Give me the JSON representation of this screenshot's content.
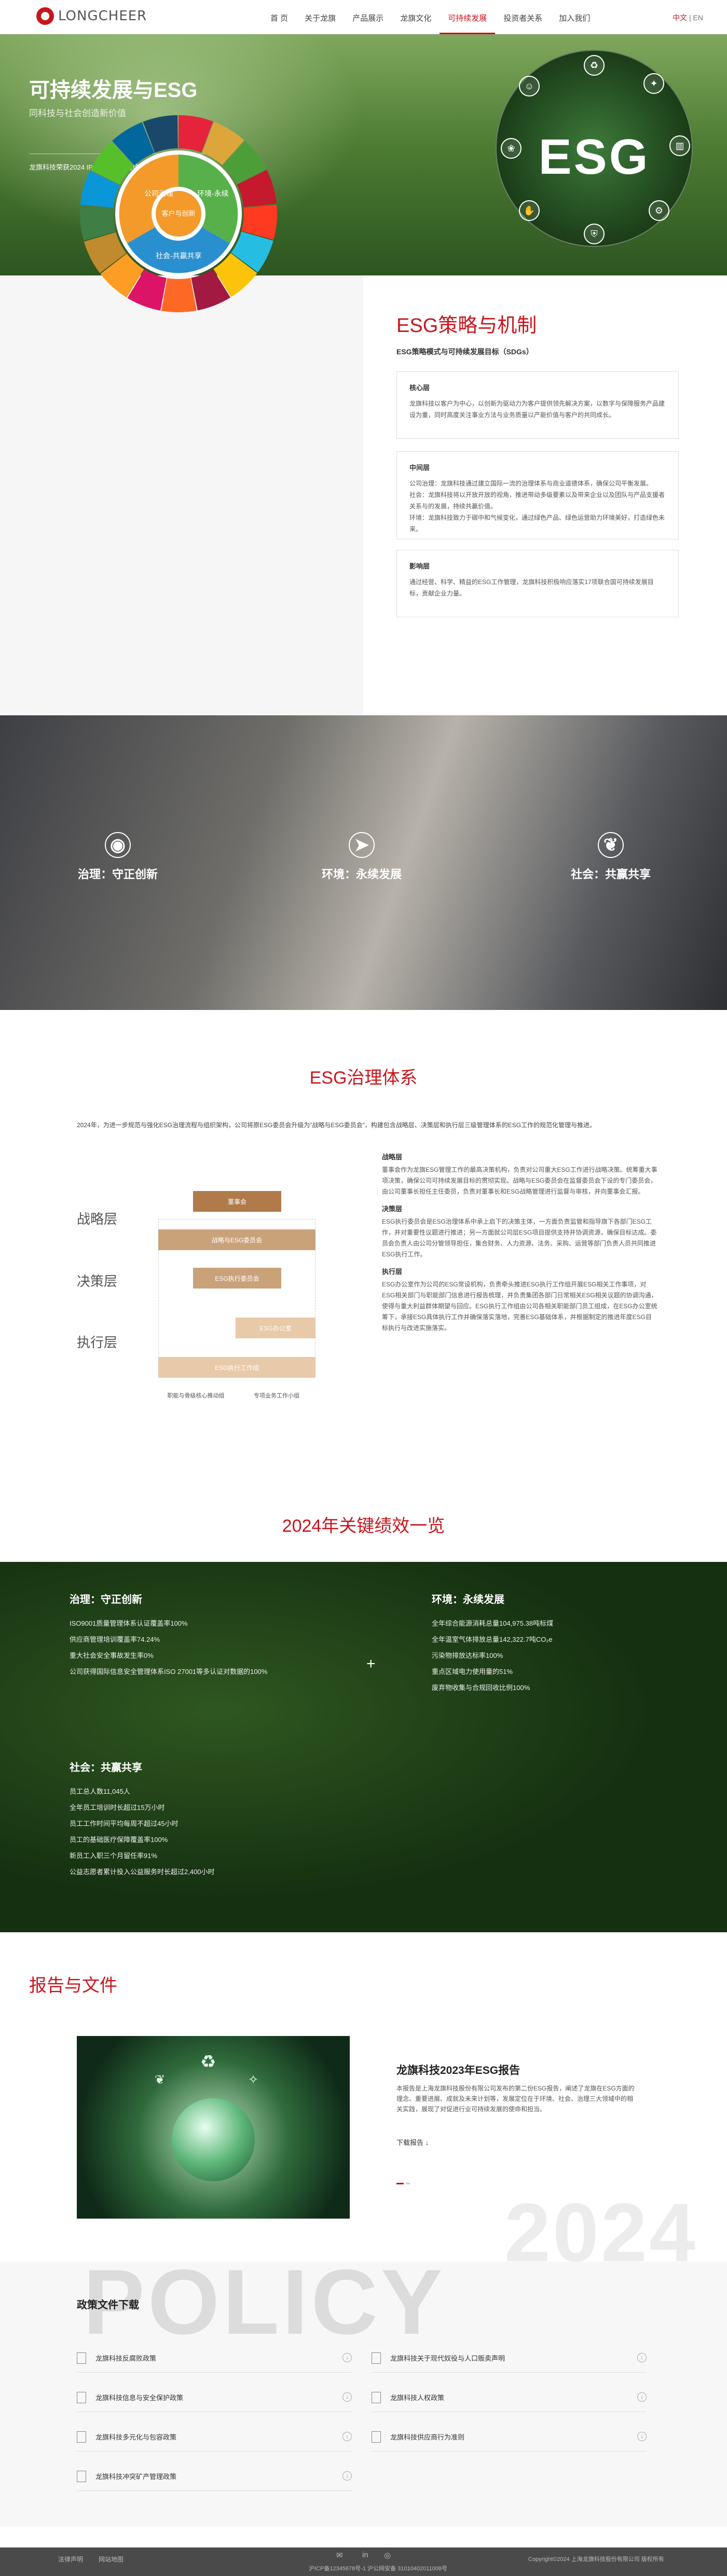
{
  "header": {
    "logo_text": "LONGCHEER",
    "nav": [
      "首 页",
      "关于龙旗",
      "产品展示",
      "龙旗文化",
      "可持续发展",
      "投资者关系",
      "加入我们"
    ],
    "active_nav": "可持续发展",
    "lang_cn": "中文",
    "lang_sep": " | ",
    "lang_en": "EN"
  },
  "hero": {
    "title": "可持续发展与ESG",
    "subtitle": "同科技与社会创造新价值",
    "note": "龙旗科技荣获2024 IPO企业ESG最佳企业奖",
    "badge": "ESG"
  },
  "strategy": {
    "title": "ESG策略与机制",
    "subtitle": "ESG策略模式与可持续发展目标（SDGs）",
    "wheel_center": "客户与创新",
    "wheel_labels": [
      "公司治理",
      "环境-永续",
      "社会-共赢共享"
    ],
    "card1_title": "核心层",
    "card1_text": "龙旗科技以客户为中心，以创新为驱动力为客户提供领先解决方案，以数字与保障服务产品建设为重，同时高度关注事业方法与业务质量以产能价值与客户的共同成长。",
    "card2_title": "中间层",
    "card2_rows": [
      "公司治理：龙旗科技通过建立国际一流的治理体系与商业道德体系，确保公司平衡发展。",
      "社会：龙旗科技将以开放开放的视角，推进带动多级要素以及带来企业以及团队与产品支援者关系与的发展，持续共赢价值。",
      "环境：龙旗科技致力于碳中和气候变化，通过绿色产品、绿色运营助力环境美好，打造绿色未来。"
    ],
    "card3_title": "影响层",
    "card3_text": "通过经营、科学、精益的ESG工作管理，龙旗科技积极响应落实17项联合国可持续发展目标，贡献企业力量。"
  },
  "pillars": [
    {
      "icon": "leaf-coin-icon",
      "label": "治理：守正创新"
    },
    {
      "icon": "paper-plane-icon",
      "label": "环境：永续发展"
    },
    {
      "icon": "leaf-icon",
      "label": "社会：共赢共享"
    }
  ],
  "governance": {
    "title": "ESG治理体系",
    "intro": "2024年，为进一步规范与强化ESG治理流程与组织架构，公司将原ESG委员会升级为“战略与ESG委员会”，构建包含战略层、决策层和执行层三级管理体系的ESG工作的规范化管理与推进。",
    "tiers": [
      "战略层",
      "决策层",
      "执行层"
    ],
    "boxes": [
      "董事会",
      "战略与ESG委员会",
      "ESG执行委员会",
      "ESG办公室",
      "ESG执行工作组",
      "职能与骨级核心推动组",
      "专项业务工作小组"
    ],
    "sections": [
      {
        "h": "战略层",
        "p": "董事会作为龙旗ESG管理工作的最高决策机构，负责对公司重大ESG工作进行战略决策。统筹重大事项决策，确保公司可持续发展目标的贯彻实现。战略与ESG委员会在监督委员会下设的专门委员会，由公司董事长担任主任委员，负责对董事长和ESG战略管理进行监督与审核，并向董事会汇报。"
      },
      {
        "h": "决策层",
        "p": "ESG执行委员会是ESG治理体系中承上启下的决策主体，一方面负责监管和指导旗下各部门ESG工作，并对重要性议题进行推进；另一方面就公司层ESG项目提供支持并协调资源，确保目标达成。委员会负责人由公司分管领导担任，集合财务、人力资源、法务、采购、运营等部门负责人员共同推进ESG执行工作。"
      },
      {
        "h": "执行层",
        "p": "ESG办公室作为公司的ESG常设机构，负责牵头推进ESG执行工作组开展ESG相关工作事项，对ESG相关部门与职能部门信息进行报告梳理，并负责集团各部门日常相关ESG相关议题的协调沟通，使得与重大利益群体期望与回应。ESG执行工作组由公司各相关职能部门员工组成，在ESG办公室统筹下，承接ESG具体执行工作并确保落实落地，完善ESG基础体系，并根据制定的推进年度ESG目标执行与改进实施落实。"
      }
    ]
  },
  "kpi": {
    "title": "2024年关键绩效一览",
    "governance_title": "治理：守正创新",
    "governance_items": [
      "ISO9001质量管理体系认证覆盖率100%",
      "供应商管理培训覆盖率74.24%",
      "重大社会安全事故发生率0%",
      "公司获得国际信息安全管理体系ISO 27001等多认证对数据的100%"
    ],
    "env_title": "环境：永续发展",
    "env_items": [
      "全年综合能源消耗总量104,975.38吨标煤",
      "全年温室气体排放总量142,322.7吨CO₂e",
      "污染物排放达标率100%",
      "重点区域电力使用量的51%",
      "废弃物收集与合规回收比例100%"
    ],
    "soc_title": "社会：共赢共享",
    "soc_items": [
      "员工总人数11,045人",
      "全年员工培训时长超过15万小时",
      "员工工作时间平均每周不超过45小时",
      "员工的基础医疗保障覆盖率100%",
      "新员工入职三个月留任率91%",
      "公益志愿者累计投入公益服务时长超过2,400小时"
    ]
  },
  "report": {
    "section_title": "报告与文件",
    "name": "龙旗科技2023年ESG报告",
    "desc": "本报告是上海龙旗科技股份有限公司发布的第二份ESG报告，阐述了龙旗在ESG方面的理念、重要进展、成就及未来计划等，发展定位在于环境、社会、治理三大领域中的相关实践，展现了对促进行业可持续发展的使命和担当。",
    "more": "下载报告",
    "year": "2024"
  },
  "policy": {
    "big_word": "POLICY",
    "title": "政策文件下载",
    "items": [
      "龙旗科技反腐败政策",
      "龙旗科技关于现代奴役与人口贩卖声明",
      "龙旗科技信息与安全保护政策",
      "龙旗科技人权政策",
      "龙旗科技多元化与包容政策",
      "龙旗科技供应商行为准则",
      "龙旗科技冲突矿产管理政策"
    ]
  },
  "footer": {
    "links": [
      "法律声明",
      "网站地图"
    ],
    "copyright": "Copyright©2024 上海龙旗科技股份有限公司 版权所有",
    "icp": "沪ICP备12345678号-1  沪公网安备 31010402011008号"
  }
}
